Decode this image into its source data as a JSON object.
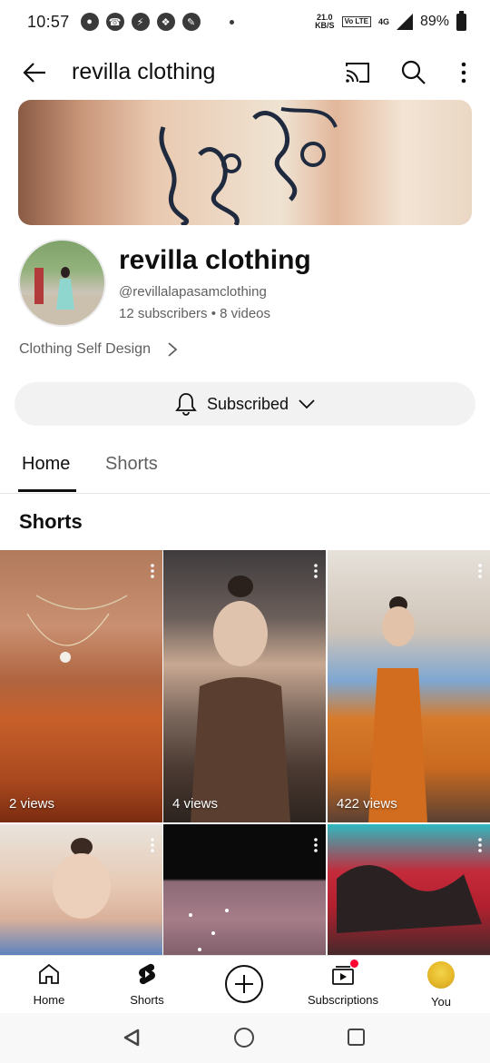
{
  "status_bar": {
    "time": "10:57",
    "net_speed_top": "21.0",
    "net_speed_bottom": "KB/S",
    "network": "4G",
    "battery": "89%"
  },
  "app_bar": {
    "title": "revilla clothing",
    "icons": [
      "back-arrow-icon",
      "cast-icon",
      "search-icon",
      "more-vert-icon"
    ]
  },
  "channel": {
    "name": "revilla clothing",
    "handle": "@revillalapasamclothing",
    "stats": "12 subscribers • 8 videos",
    "description": "Clothing Self Design",
    "subscribe_label": "Subscribed"
  },
  "tabs": [
    {
      "label": "Home",
      "active": true
    },
    {
      "label": "Shorts",
      "active": false
    }
  ],
  "section": {
    "title": "Shorts"
  },
  "shorts": [
    {
      "views": "2 views"
    },
    {
      "views": "4 views"
    },
    {
      "views": "422 views"
    },
    {
      "views": ""
    },
    {
      "views": ""
    },
    {
      "views": ""
    }
  ],
  "bottom_nav": [
    {
      "label": "Home",
      "icon": "home-icon"
    },
    {
      "label": "Shorts",
      "icon": "shorts-icon"
    },
    {
      "label": "",
      "icon": "create-icon"
    },
    {
      "label": "Subscriptions",
      "icon": "subscriptions-icon"
    },
    {
      "label": "You",
      "icon": "avatar"
    }
  ],
  "colors": {
    "text_primary": "#0f0f0f",
    "text_secondary": "#606060",
    "button_bg": "#f2f2f2",
    "notification_red": "#ff0033"
  }
}
